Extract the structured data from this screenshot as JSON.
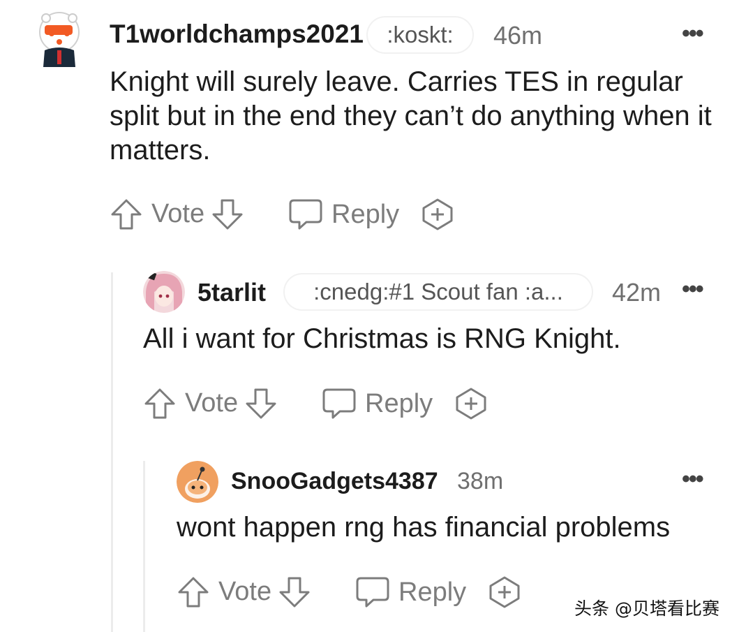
{
  "comments": [
    {
      "username": "T1worldchamps2021",
      "flair": ":koskt:",
      "time": "46m",
      "text": "Knight will surely leave. Carries TES in regular split but in the end they can’t do anything when it matters.",
      "avatar_icon": "snoo-avatar-icon",
      "actions": {
        "vote": "Vote",
        "reply": "Reply"
      }
    },
    {
      "username": "5tarlit",
      "flair": ":cnedg:#1 Scout fan :a...",
      "time": "42m",
      "text": "All i want for Christmas is RNG Knight.",
      "avatar_icon": "anime-avatar-icon",
      "actions": {
        "vote": "Vote",
        "reply": "Reply"
      }
    },
    {
      "username": "SnooGadgets4387",
      "time": "38m",
      "text": "wont happen rng has financial problems",
      "avatar_icon": "snoo-avatar-icon",
      "actions": {
        "vote": "Vote",
        "reply": "Reply"
      }
    }
  ],
  "more_label": "•••",
  "watermark": "头条 @贝塔看比赛",
  "colors": {
    "text": "#1c1c1c",
    "muted": "#7c7c7c",
    "thread_line": "#ececec",
    "avatar_orange": "#f0a060"
  }
}
